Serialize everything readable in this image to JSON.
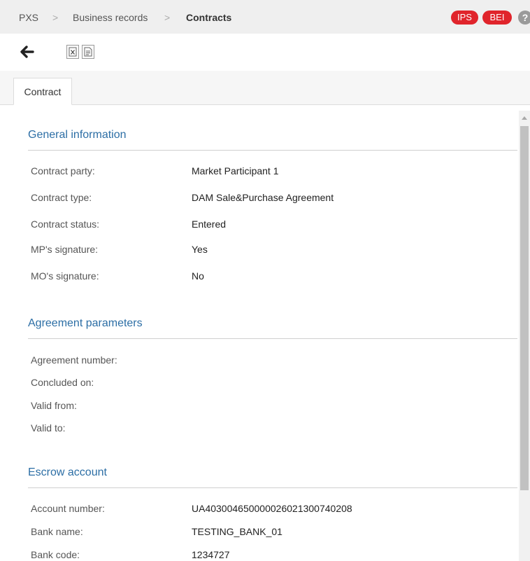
{
  "breadcrumb": {
    "items": [
      "PXS",
      "Business records",
      "Contracts"
    ],
    "separator": ">"
  },
  "header_badges": [
    "IPS",
    "BEI"
  ],
  "header_help": "?",
  "toolbar": {
    "icons": [
      "back-arrow-icon",
      "excel-export-icon",
      "document-export-icon"
    ]
  },
  "tabs": [
    "Contract"
  ],
  "sections": {
    "general": {
      "title": "General information",
      "rows": [
        {
          "label": "Contract party:",
          "value": "Market Participant 1"
        },
        {
          "label": "Contract type:",
          "value": "DAM Sale&Purchase Agreement"
        },
        {
          "label": "Contract status:",
          "value": "Entered"
        },
        {
          "label": "MP's signature:",
          "value": "Yes"
        },
        {
          "label": "MO's signature:",
          "value": "No"
        }
      ]
    },
    "agreement": {
      "title": "Agreement parameters",
      "rows": [
        {
          "label": "Agreement number:",
          "value": ""
        },
        {
          "label": "Concluded on:",
          "value": ""
        },
        {
          "label": "Valid from:",
          "value": ""
        },
        {
          "label": "Valid to:",
          "value": ""
        }
      ]
    },
    "escrow": {
      "title": "Escrow account",
      "rows": [
        {
          "label": "Account number:",
          "value": "UA403004650000026021300740208"
        },
        {
          "label": "Bank name:",
          "value": "TESTING_BANK_01"
        },
        {
          "label": "Bank code:",
          "value": "1234727"
        }
      ]
    }
  },
  "colors": {
    "accent": "#2c6ea5",
    "badge": "#e0242b"
  }
}
